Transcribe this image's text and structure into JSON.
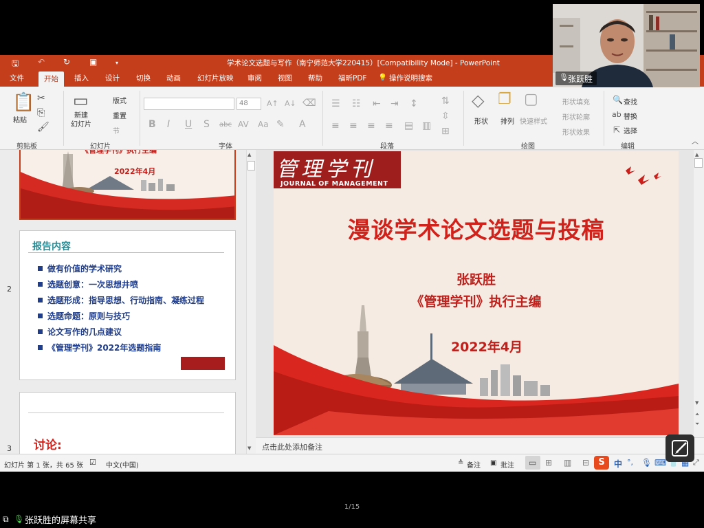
{
  "window": {
    "title": "学术论文选题与写作（南宁师范大学220415）[Compatibility Mode]  -  PowerPoint"
  },
  "tabs": [
    "文件",
    "开始",
    "插入",
    "设计",
    "切换",
    "动画",
    "幻灯片放映",
    "审阅",
    "视图",
    "帮助",
    "福昕PDF"
  ],
  "search_label": "操作说明搜索",
  "ribbon": {
    "clipboard": {
      "label": "剪贴板",
      "paste": "粘贴"
    },
    "slides": {
      "label": "幻灯片",
      "new_slide": "新建\n幻灯片",
      "layout": "版式",
      "reset": "重置",
      "section": "节"
    },
    "font": {
      "label": "字体",
      "size": "48",
      "formats": [
        "B",
        "I",
        "U",
        "S",
        "abc",
        "AV",
        "Aa",
        "A"
      ]
    },
    "paragraph": {
      "label": "段落"
    },
    "drawing": {
      "label": "绘图",
      "shape": "形状",
      "arrange": "排列",
      "quick_style": "快速样式",
      "shape_fill": "形状填充",
      "shape_outline": "形状轮廓",
      "shape_effect": "形状效果"
    },
    "editing": {
      "label": "编辑",
      "find": "查找",
      "replace": "替换",
      "select": "选择"
    }
  },
  "thumbnails": {
    "slide1": {
      "date": "2022年4月",
      "partial_title": "《管理学刊》执行主编"
    },
    "slide2": {
      "number": "2",
      "title": "报告内容",
      "items": [
        "做有价值的学术研究",
        "选题创意：一次思想井喷",
        "选题形成：指导思想、行动指南、凝练过程",
        "选题命题：原则与技巧",
        "论文写作的几点建议",
        "《管理学刊》2022年选题指南"
      ]
    },
    "slide3": {
      "number": "3",
      "text": "讨论:"
    }
  },
  "slide": {
    "logo_cn": "管理学刊",
    "logo_en": "JOURNAL OF MANAGEMENT",
    "title": "漫谈学术论文选题与投稿",
    "author": "张跃胜",
    "role": "《管理学刊》执行主编",
    "date": "2022年4月"
  },
  "notes_placeholder": "点击此处添加备注",
  "status": {
    "slide_info": "幻灯片 第 1 张，共 65 张",
    "language": "中文(中国)",
    "notes": "备注",
    "comments": "批注",
    "ime": [
      "中",
      "°,"
    ]
  },
  "webcam": {
    "name": "张跃胜"
  },
  "pager": "1/15",
  "share_label": "张跃胜的屏幕共享",
  "colors": {
    "accent": "#c43e1c",
    "slide_red": "#d0211b",
    "thumb_blue": "#1f3d8a",
    "thumb_teal": "#2b8b94"
  }
}
